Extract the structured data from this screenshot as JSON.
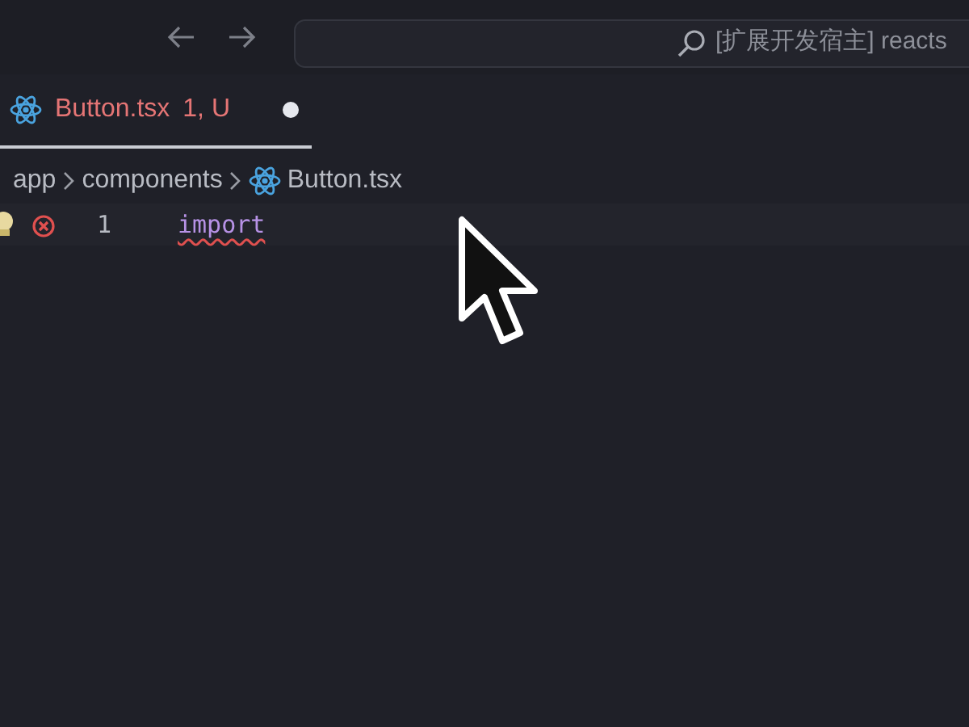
{
  "title_bar": {
    "search_text": "[扩展开发宿主] reacts"
  },
  "tabs": [
    {
      "label": "Button.tsx",
      "status": "1, U",
      "modified": true,
      "selected": true
    }
  ],
  "breadcrumb": [
    "app",
    "components",
    "Button.tsx"
  ],
  "editor": {
    "lines": [
      {
        "number": "1",
        "code": "import",
        "error": true
      }
    ]
  }
}
